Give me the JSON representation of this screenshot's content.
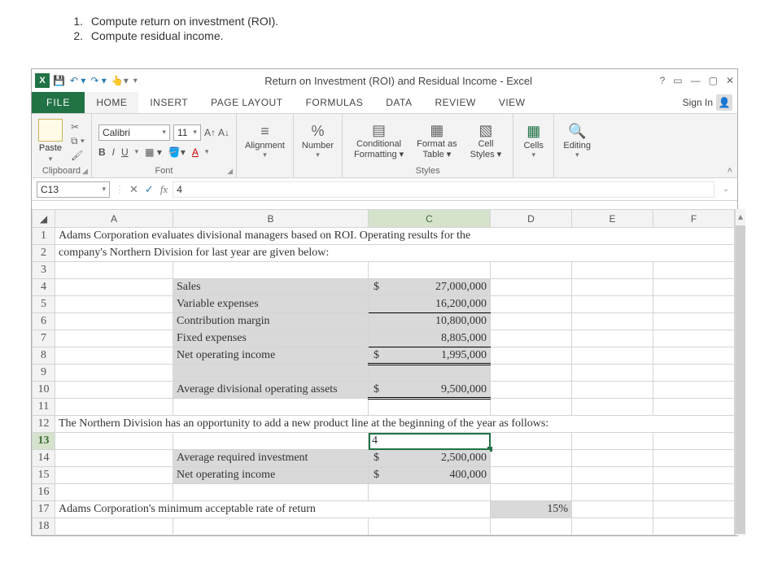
{
  "instructions": {
    "item1_num": "1.",
    "item1": "Compute return on investment (ROI).",
    "item2_num": "2.",
    "item2": "Compute residual income."
  },
  "titlebar": {
    "title": "Return on Investment (ROI) and Residual Income - Excel"
  },
  "tabs": {
    "file": "FILE",
    "home": "HOME",
    "insert": "INSERT",
    "page_layout": "PAGE LAYOUT",
    "formulas": "FORMULAS",
    "data": "DATA",
    "review": "REVIEW",
    "view": "VIEW",
    "signin": "Sign In"
  },
  "ribbon": {
    "paste": "Paste",
    "clipboard": "Clipboard",
    "font_name": "Calibri",
    "font_size": "11",
    "font": "Font",
    "alignment": "Alignment",
    "number": "Number",
    "cond_fmt_l1": "Conditional",
    "cond_fmt_l2": "Formatting",
    "fmt_table_l1": "Format as",
    "fmt_table_l2": "Table",
    "cell_styles_l1": "Cell",
    "cell_styles_l2": "Styles",
    "styles": "Styles",
    "cells": "Cells",
    "editing": "Editing"
  },
  "formula_bar": {
    "name_box": "C13",
    "value": "4"
  },
  "columns": {
    "A": "A",
    "B": "B",
    "C": "C",
    "D": "D",
    "E": "E",
    "F": "F"
  },
  "rows": {
    "r1": "1",
    "r2": "2",
    "r3": "3",
    "r4": "4",
    "r5": "5",
    "r6": "6",
    "r7": "7",
    "r8": "8",
    "r9": "9",
    "r10": "10",
    "r11": "11",
    "r12": "12",
    "r13": "13",
    "r14": "14",
    "r15": "15",
    "r16": "16",
    "r17": "17",
    "r18": "18"
  },
  "cells": {
    "A1": "Adams Corporation evaluates divisional managers based on ROI. Operating results for the",
    "A2": "company's Northern Division for last year are given below:",
    "B4": "Sales",
    "C4": "27,000,000",
    "B5": "Variable expenses",
    "C5": "16,200,000",
    "B6": "Contribution margin",
    "C6": "10,800,000",
    "B7": "Fixed expenses",
    "C7": "8,805,000",
    "B8": "Net operating income",
    "C8": "1,995,000",
    "B10": "Average divisional operating assets",
    "C10": "9,500,000",
    "A12": "The Northern Division has an opportunity to add a new product line at the beginning of the year as follows:",
    "C13": "4",
    "B14": "Average required investment",
    "C14": "2,500,000",
    "B15": "Net operating income",
    "C15": "400,000",
    "A17": "Adams Corporation's minimum acceptable rate of return",
    "D17": "15%"
  }
}
